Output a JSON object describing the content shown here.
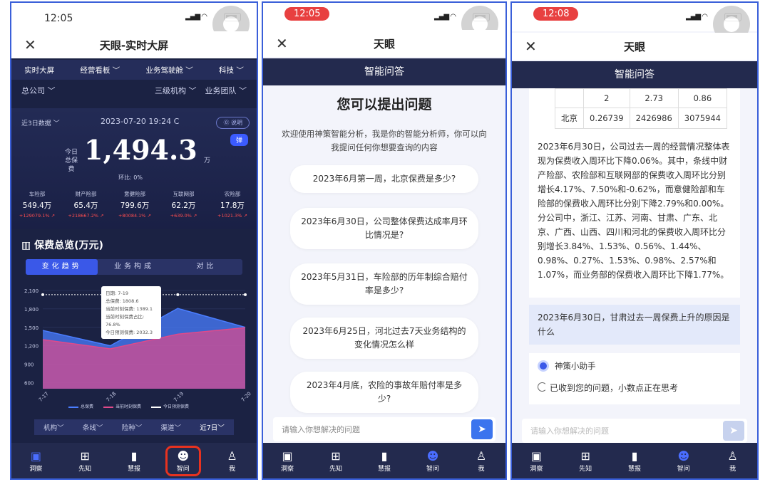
{
  "phone1": {
    "time": "12:05",
    "title": "天眼-实时大屏",
    "nav": [
      "实时大屏",
      "经营看板 ﹀",
      "业务驾驶舱 ﹀",
      "科技 ﹀"
    ],
    "filter_left": "总公司 ﹀",
    "filter_right": [
      "三级机构 ﹀",
      "业务团队 ﹀"
    ],
    "range": "近3日数据 ﹀",
    "datetime": "2023-07-20 19:24 C",
    "explain": "⓪ 说明",
    "hot": "弹",
    "kpi_label": "今日总保费",
    "kpi_value": "1,494.3",
    "kpi_unit": "万",
    "ratio": "环比: 0%",
    "metrics": [
      {
        "name": "车险部",
        "value": "549.4万",
        "change": "+129079.1% ↗"
      },
      {
        "name": "财产险部",
        "value": "65.4万",
        "change": "+218667.2% ↗"
      },
      {
        "name": "意健险部",
        "value": "799.6万",
        "change": "+80084.1% ↗"
      },
      {
        "name": "互联网部",
        "value": "62.2万",
        "change": "+639.0% ↗"
      },
      {
        "name": "农险部",
        "value": "17.8万",
        "change": "+1021.3% ↗"
      }
    ],
    "section": "保费总览(万元)",
    "segments": [
      "变化趋势",
      "业务构成",
      "对比"
    ],
    "tooltip": [
      "日期: 7-19",
      "总保费: 1808.6",
      "当前时刻保费: 1389.1",
      "当前时刻保费占比: 76.8%",
      "今日预测保费: 2032.3"
    ],
    "legend": [
      "总保费",
      "当前时刻保费",
      "今日预测保费"
    ],
    "bottom_filters": [
      "机构﹀",
      "条线﹀",
      "险种﹀",
      "渠道﹀",
      "近7日﹀"
    ]
  },
  "chart_data": {
    "type": "area",
    "x": [
      "7-17",
      "7-18",
      "7-19",
      "7-20"
    ],
    "ylim": [
      500,
      2100
    ],
    "yticks": [
      600,
      900,
      1200,
      1500,
      1800,
      2100
    ],
    "series": [
      {
        "name": "总保费",
        "values": [
          1450,
          1200,
          1808.6,
          1500
        ]
      },
      {
        "name": "当前时刻保费",
        "values": [
          1300,
          1150,
          1389.1,
          1494.3
        ]
      },
      {
        "name": "今日预测保费",
        "values": [
          2032.3,
          2032.3,
          2032.3,
          2032.3
        ]
      }
    ]
  },
  "tabs": [
    "洞察",
    "先知",
    "慧报",
    "智问",
    "我"
  ],
  "phone2": {
    "time": "12:05",
    "title": "天眼",
    "header": "智能问答",
    "heading": "您可以提出问题",
    "intro": "欢迎使用神策智能分析，我是你的智能分析师，你可以向我提问任何你想要查询的内容",
    "questions": [
      "2023年6月第一周，北京保费是多少?",
      "2023年6月30日，公司整体保费达成率月环比情况是?",
      "2023年5月31日，车险部的历年制综合赔付率是多少?",
      "2023年6月25日，河北过去7天业务结构的变化情况怎么样",
      "2023年4月底，农险的事故年赔付率是多少?"
    ],
    "placeholder": "请输入你想解决的问题"
  },
  "phone3": {
    "time": "12:08",
    "title": "天眼",
    "header": "智能问答",
    "table": [
      [
        "",
        "2",
        "2.73",
        "0.86"
      ],
      [
        "北京",
        "0.26739",
        "2426986",
        "3075944"
      ]
    ],
    "answer": "2023年6月30日，公司过去一周的经营情况整体表现为保费收入周环比下降0.06%。其中，条线中财产险部、农险部和互联网部的保费收入周环比分别增长4.17%、7.50%和-0.62%，而意健险部和车险部的保费收入周环比分别下降2.79%和0.00%。分公司中，浙江、江苏、河南、甘肃、广东、北京、广西、山西、四川和河北的保费收入周环比分别增长3.84%、1.53%、0.56%、1.44%、0.98%、0.27%、1.53%、0.98%、2.57%和1.07%，而业务部的保费收入周环比下降1.77%。",
    "user_question": "2023年6月30日，甘肃过去一周保费上升的原因是什么",
    "bot_name": "神策小助手",
    "bot_status": "已收到您的问题，小数点正在思考",
    "placeholder": "请输入你想解决的问题"
  }
}
